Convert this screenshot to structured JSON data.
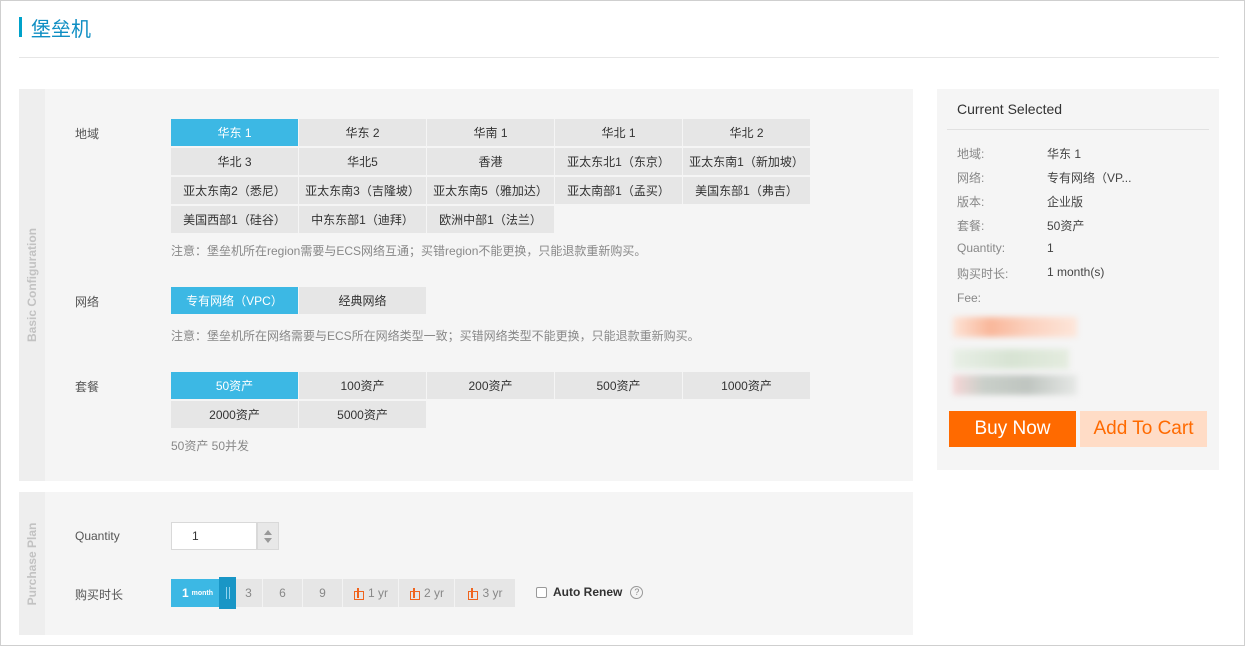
{
  "page_title": "堡垒机",
  "basic_config": {
    "side_label": "Basic Configuration",
    "region": {
      "label": "地域",
      "options": [
        "华东 1",
        "华东 2",
        "华南 1",
        "华北 1",
        "华北 2",
        "华北 3",
        "华北5",
        "香港",
        "亚太东北1（东京）",
        "亚太东南1（新加坡）",
        "亚太东南2（悉尼）",
        "亚太东南3（吉隆坡）",
        "亚太东南5（雅加达）",
        "亚太南部1（孟买）",
        "美国东部1（弗吉）",
        "美国西部1（硅谷）",
        "中东东部1（迪拜）",
        "欧洲中部1（法兰）"
      ],
      "selected": "华东 1",
      "note": "注意：堡垒机所在region需要与ECS网络互通；买错region不能更换，只能退款重新购买。"
    },
    "network": {
      "label": "网络",
      "options": [
        "专有网络（VPC）",
        "经典网络"
      ],
      "selected": "专有网络（VPC）",
      "note": "注意：堡垒机所在网络需要与ECS所在网络类型一致；买错网络类型不能更换，只能退款重新购买。"
    },
    "package": {
      "label": "套餐",
      "options": [
        "50资产",
        "100资产",
        "200资产",
        "500资产",
        "1000资产",
        "2000资产",
        "5000资产"
      ],
      "selected": "50资产",
      "note": "50资产 50并发"
    }
  },
  "purchase_plan": {
    "side_label": "Purchase Plan",
    "quantity": {
      "label": "Quantity",
      "value": "1"
    },
    "duration": {
      "label": "购买时长",
      "active_value": "1",
      "active_unit": "month",
      "steps": [
        "3",
        "6",
        "9"
      ],
      "year_steps": [
        "1 yr",
        "2 yr",
        "3 yr"
      ],
      "gift_icon": "gift-icon"
    },
    "auto_renew": {
      "label": "Auto Renew",
      "checked": false,
      "help": "?"
    }
  },
  "summary": {
    "title": "Current Selected",
    "rows": [
      {
        "key": "地域:",
        "value": "华东 1"
      },
      {
        "key": "网络:",
        "value": "专有网络（VP..."
      },
      {
        "key": "版本:",
        "value": "企业版"
      },
      {
        "key": "套餐:",
        "value": "50资产"
      },
      {
        "key": "Quantity:",
        "value": "1"
      },
      {
        "key": "购买时长:",
        "value": "1 month(s)"
      }
    ],
    "fee_label": "Fee:",
    "buy_now": "Buy Now",
    "add_to_cart": "Add To Cart"
  },
  "colors": {
    "accent": "#3cb8e4",
    "title": "#0e8ec3",
    "buy": "#ff6a00",
    "cart_bg": "#ffdcc6"
  }
}
